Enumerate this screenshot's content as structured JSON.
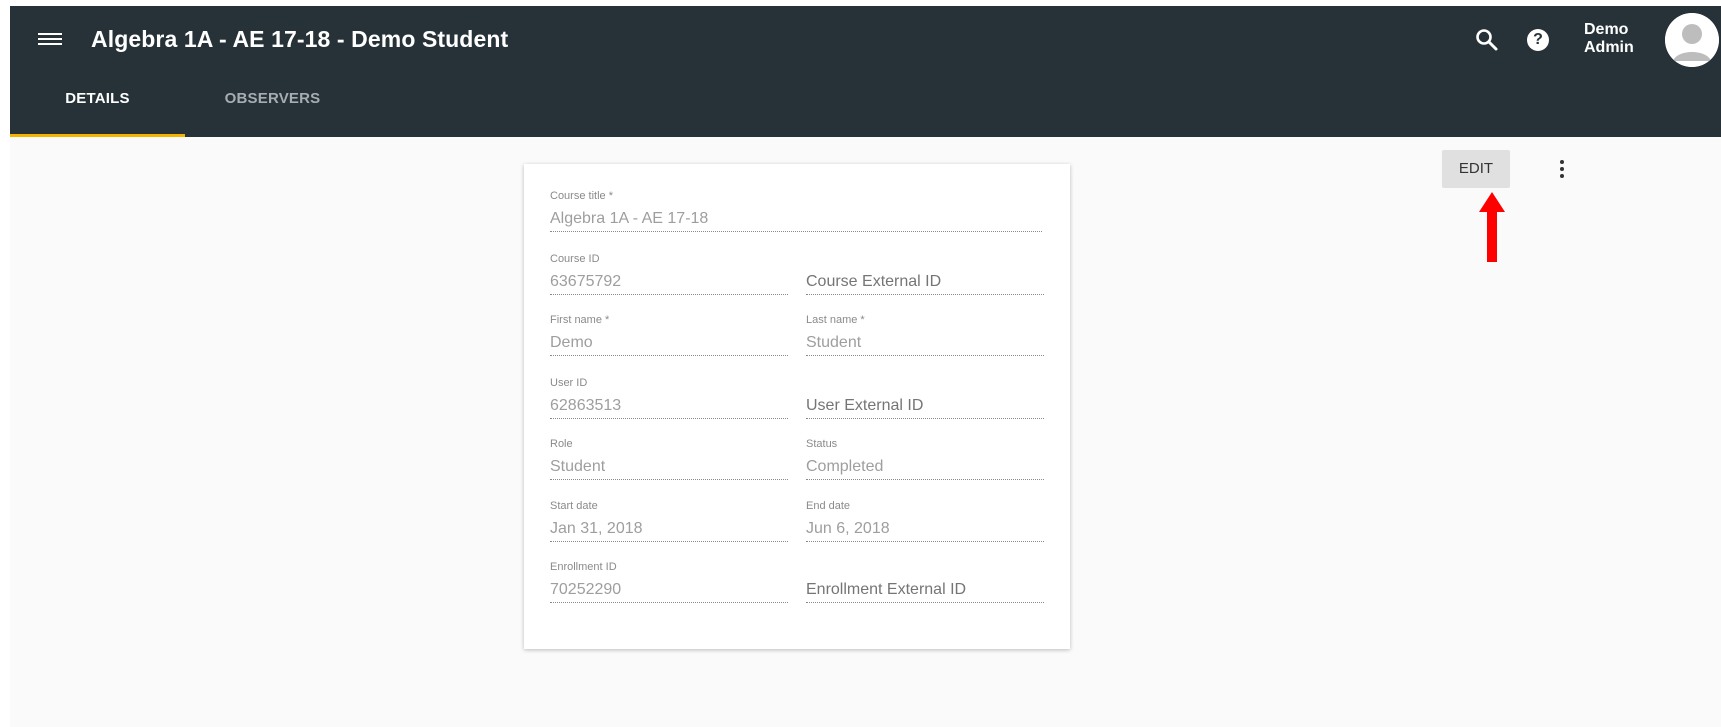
{
  "header": {
    "title": "Algebra 1A - AE 17-18 - Demo Student",
    "user_first": "Demo",
    "user_last": "Admin",
    "help_label": "?"
  },
  "tabs": [
    {
      "label": "DETAILS",
      "active": true
    },
    {
      "label": "OBSERVERS",
      "active": false
    }
  ],
  "form": {
    "course_title": {
      "label": "Course title *",
      "value": "Algebra 1A - AE 17-18"
    },
    "course_id": {
      "label": "Course ID",
      "value": "63675792"
    },
    "course_external_id": {
      "placeholder": "Course External ID"
    },
    "first_name": {
      "label": "First name *",
      "value": "Demo"
    },
    "last_name": {
      "label": "Last name *",
      "value": "Student"
    },
    "user_id": {
      "label": "User ID",
      "value": "62863513"
    },
    "user_external_id": {
      "placeholder": "User External ID"
    },
    "role": {
      "label": "Role",
      "value": "Student"
    },
    "status": {
      "label": "Status",
      "value": "Completed"
    },
    "start_date": {
      "label": "Start date",
      "value": "Jan 31, 2018"
    },
    "end_date": {
      "label": "End date",
      "value": "Jun 6, 2018"
    },
    "enrollment_id": {
      "label": "Enrollment ID",
      "value": "70252290"
    },
    "enrollment_external_id": {
      "placeholder": "Enrollment External ID"
    }
  },
  "actions": {
    "edit_label": "EDIT"
  },
  "colors": {
    "header_bg": "#263238",
    "tab_indicator": "#f5b400",
    "annotation_arrow": "#ff0000"
  },
  "icons": [
    "menu-icon",
    "search-icon",
    "help-icon",
    "avatar-icon",
    "more-vert-icon",
    "red-arrow-annotation"
  ]
}
